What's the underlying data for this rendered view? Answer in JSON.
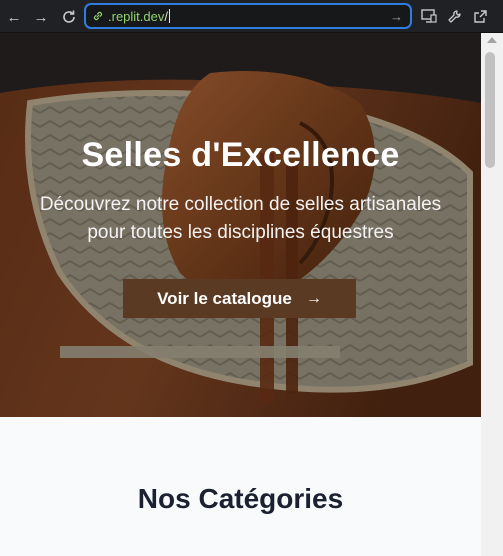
{
  "browser": {
    "url_host": ".replit.dev",
    "url_path": "/",
    "icons": [
      "back-arrow-icon",
      "forward-arrow-icon",
      "reload-icon",
      "link-icon",
      "go-arrow-icon",
      "screen-cast-icon",
      "wrench-icon",
      "open-external-icon"
    ]
  },
  "hero": {
    "title": "Selles d'Excellence",
    "subtitle_line1": "Découvrez notre collection de selles artisanales",
    "subtitle_line2": "pour toutes les disciplines équestres",
    "cta_label": "Voir le catalogue",
    "cta_icon": "→",
    "cta_color": "#5b3a23"
  },
  "categories": {
    "title": "Nos Catégories"
  },
  "colors": {
    "url_focus": "#2f7de1",
    "host_green": "#92d36e",
    "page_bg": "#f8fafc"
  }
}
